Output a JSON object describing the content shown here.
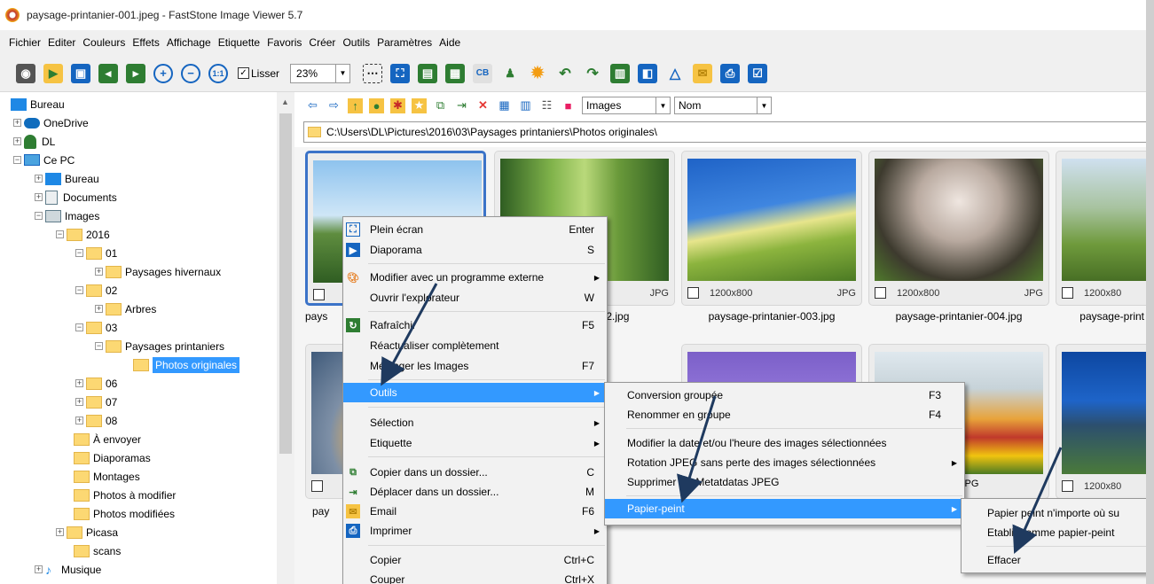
{
  "window": {
    "title": "paysage-printanier-001.jpeg  -  FastStone Image Viewer 5.7"
  },
  "menubar": [
    "Fichier",
    "Editer",
    "Couleurs",
    "Effets",
    "Affichage",
    "Etiquette",
    "Favoris",
    "Créer",
    "Outils",
    "Paramètres",
    "Aide"
  ],
  "toolbar": {
    "lisser_label": "Lisser",
    "zoom_value": "23%",
    "icons": [
      "camera-icon",
      "open-folder-icon",
      "save-icon",
      "previous-icon",
      "next-icon",
      "zoom-in-icon",
      "zoom-out-icon",
      "actual-size-icon",
      "fit-window-icon",
      "fullscreen-icon",
      "slideshow-icon",
      "image-info-icon",
      "color-icon",
      "crop-icon",
      "user-icon",
      "effects-icon",
      "rotate-left-icon",
      "rotate-right-icon",
      "compare-icon",
      "resize-icon",
      "draw-icon",
      "email-icon",
      "print-icon",
      "settings-icon"
    ]
  },
  "tree": {
    "items": [
      {
        "label": "Bureau",
        "icon": "desktop-icon"
      },
      {
        "label": "OneDrive",
        "icon": "cloud-icon"
      },
      {
        "label": "DL",
        "icon": "user-icon"
      },
      {
        "label": "Ce PC",
        "icon": "computer-icon"
      },
      {
        "label": "Bureau",
        "icon": "desktop-icon"
      },
      {
        "label": "Documents",
        "icon": "document-icon"
      },
      {
        "label": "Images",
        "icon": "images-icon"
      },
      {
        "label": "2016",
        "icon": "folder-icon"
      },
      {
        "label": "01",
        "icon": "folder-icon"
      },
      {
        "label": "Paysages hivernaux",
        "icon": "folder-icon"
      },
      {
        "label": "02",
        "icon": "folder-icon"
      },
      {
        "label": "Arbres",
        "icon": "folder-icon"
      },
      {
        "label": "03",
        "icon": "folder-icon"
      },
      {
        "label": "Paysages printaniers",
        "icon": "folder-icon"
      },
      {
        "label": "Photos originales",
        "icon": "folder-icon"
      },
      {
        "label": "06",
        "icon": "folder-icon"
      },
      {
        "label": "07",
        "icon": "folder-icon"
      },
      {
        "label": "08",
        "icon": "folder-icon"
      },
      {
        "label": "À envoyer",
        "icon": "folder-icon"
      },
      {
        "label": "Diaporamas",
        "icon": "folder-icon"
      },
      {
        "label": "Montages",
        "icon": "folder-icon"
      },
      {
        "label": "Photos à modifier",
        "icon": "folder-icon"
      },
      {
        "label": "Photos modifiées",
        "icon": "folder-icon"
      },
      {
        "label": "Picasa",
        "icon": "folder-icon"
      },
      {
        "label": "scans",
        "icon": "folder-icon"
      },
      {
        "label": "Musique",
        "icon": "music-icon"
      }
    ]
  },
  "browser": {
    "view_select": "Images",
    "sort_select": "Nom",
    "path": "C:\\Users\\DL\\Pictures\\2016\\03\\Paysages printaniers\\Photos originales\\",
    "thumbnails": [
      {
        "name": "pays",
        "dim": "",
        "format": ""
      },
      {
        "name": "r-002.jpg",
        "dim": "",
        "format": "JPG"
      },
      {
        "name": "paysage-printanier-003.jpg",
        "dim": "1200x800",
        "format": "JPG"
      },
      {
        "name": "paysage-printanier-004.jpg",
        "dim": "1200x800",
        "format": "JPG"
      },
      {
        "name": "paysage-print",
        "dim": "1200x80",
        "format": ""
      },
      {
        "name": "pay",
        "dim": "",
        "format": ""
      },
      {
        "name": "",
        "dim": "",
        "format": ""
      },
      {
        "name": "",
        "dim": "",
        "format": ""
      },
      {
        "name": "",
        "dim": "",
        "format": "JPG"
      },
      {
        "name": "",
        "dim": "1200x80",
        "format": ""
      }
    ]
  },
  "context_menu": {
    "items": [
      {
        "label": "Plein écran",
        "shortcut": "Enter",
        "icon": "fullscreen-icon"
      },
      {
        "label": "Diaporama",
        "shortcut": "S",
        "icon": "slideshow-icon"
      },
      {
        "label": "Modifier avec un programme externe",
        "shortcut": "",
        "icon": "palette-icon"
      },
      {
        "label": "Ouvrir l'explorateur",
        "shortcut": "W",
        "icon": ""
      },
      {
        "label": "Rafraîchir",
        "shortcut": "F5",
        "icon": "refresh-icon"
      },
      {
        "label": "Réactualiser complètement",
        "shortcut": "",
        "icon": ""
      },
      {
        "label": "Mélanger les Images",
        "shortcut": "F7",
        "icon": ""
      },
      {
        "label": "Outils",
        "shortcut": "",
        "icon": ""
      },
      {
        "label": "Sélection",
        "shortcut": "",
        "icon": ""
      },
      {
        "label": "Etiquette",
        "shortcut": "",
        "icon": ""
      },
      {
        "label": "Copier dans un dossier...",
        "shortcut": "C",
        "icon": "copy-folder-icon"
      },
      {
        "label": "Déplacer dans un dossier...",
        "shortcut": "M",
        "icon": "move-folder-icon"
      },
      {
        "label": "Email",
        "shortcut": "F6",
        "icon": "email-icon"
      },
      {
        "label": "Imprimer",
        "shortcut": "",
        "icon": "print-icon"
      },
      {
        "label": "Copier",
        "shortcut": "Ctrl+C",
        "icon": ""
      },
      {
        "label": "Couper",
        "shortcut": "Ctrl+X",
        "icon": ""
      }
    ]
  },
  "outils_menu": {
    "items": [
      {
        "label": "Conversion groupée",
        "shortcut": "F3"
      },
      {
        "label": "Renommer en groupe",
        "shortcut": "F4"
      },
      {
        "label": "Modifier la date et/ou l'heure des images sélectionnées",
        "shortcut": ""
      },
      {
        "label": "Rotation JPEG sans perte des images sélectionnées",
        "shortcut": ""
      },
      {
        "label": "Supprimer les Metatdatas JPEG",
        "shortcut": ""
      },
      {
        "label": "Papier-peint",
        "shortcut": ""
      }
    ]
  },
  "papier_menu": {
    "items": [
      {
        "label": "Papier peint n'importe où su"
      },
      {
        "label": "Etablir comme papier-peint"
      },
      {
        "label": "Effacer"
      }
    ]
  },
  "colors": {
    "accent": "#3399ff",
    "selection_border": "#3b73c8",
    "arrow": "#1f3a5f"
  }
}
